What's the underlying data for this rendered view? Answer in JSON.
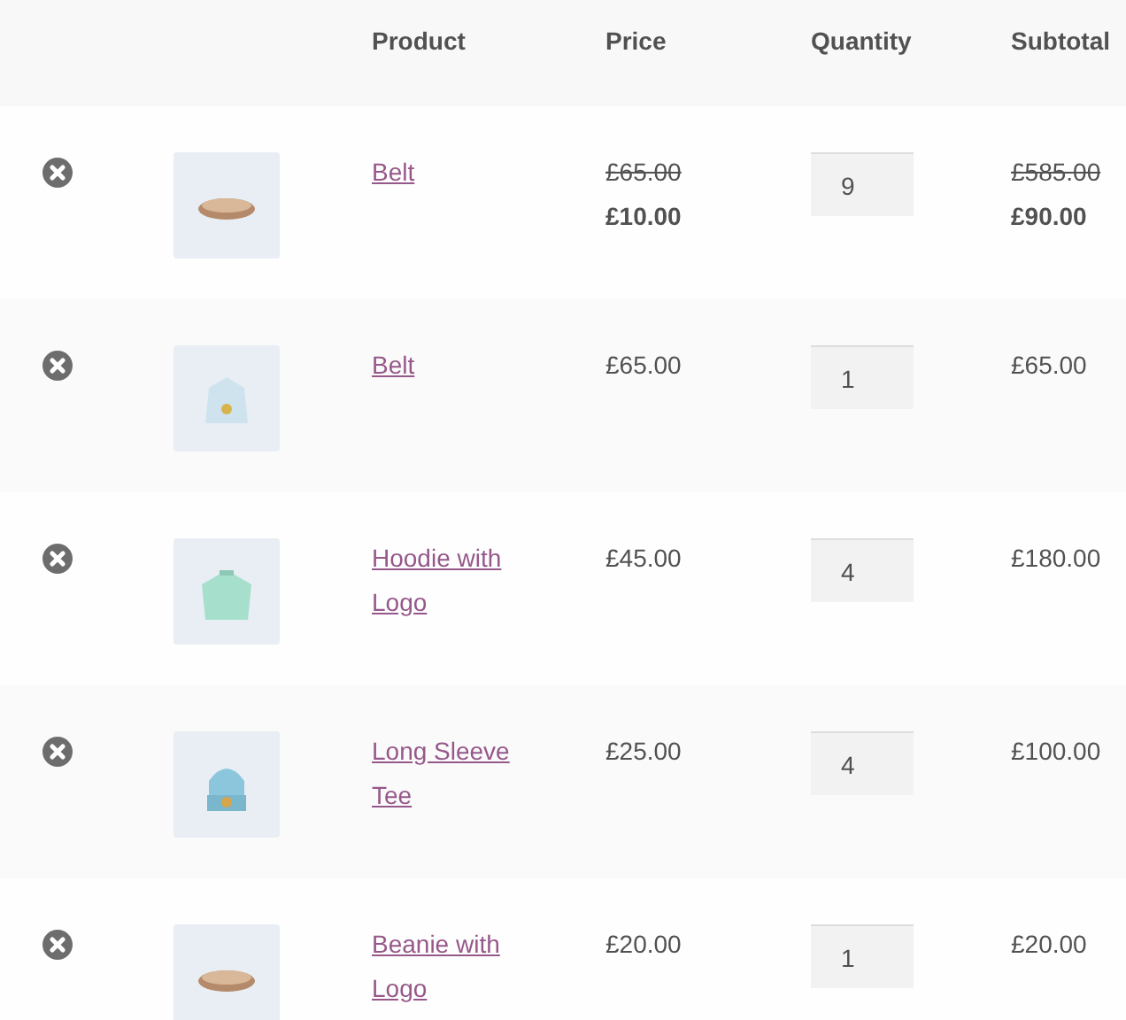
{
  "table": {
    "columns": [
      {
        "label": "Product"
      },
      {
        "label": "Price"
      },
      {
        "label": "Quantity"
      },
      {
        "label": "Subtotal"
      }
    ],
    "rows": [
      {
        "product": "Belt",
        "price": {
          "kind": "sale",
          "regular": "£65.00",
          "sale": "£10.00"
        },
        "quantity": "9",
        "subtotal": {
          "kind": "sale",
          "regular": "£585.00",
          "sale": "£90.00"
        }
      },
      {
        "product": "Belt",
        "price": {
          "kind": "plain",
          "amount": "£65.00"
        },
        "quantity": "1",
        "subtotal": {
          "kind": "plain",
          "amount": "£65.00"
        }
      },
      {
        "product": "Hoodie with Logo",
        "price": {
          "kind": "plain",
          "amount": "£45.00"
        },
        "quantity": "4",
        "subtotal": {
          "kind": "plain",
          "amount": "£180.00"
        }
      },
      {
        "product": "Long Sleeve Tee",
        "price": {
          "kind": "plain",
          "amount": "£25.00"
        },
        "quantity": "4",
        "subtotal": {
          "kind": "plain",
          "amount": "£100.00"
        }
      },
      {
        "product": "Beanie with Logo",
        "price": {
          "kind": "plain",
          "amount": "£20.00"
        },
        "quantity": "1",
        "subtotal": {
          "kind": "plain",
          "amount": "£20.00"
        }
      }
    ]
  }
}
